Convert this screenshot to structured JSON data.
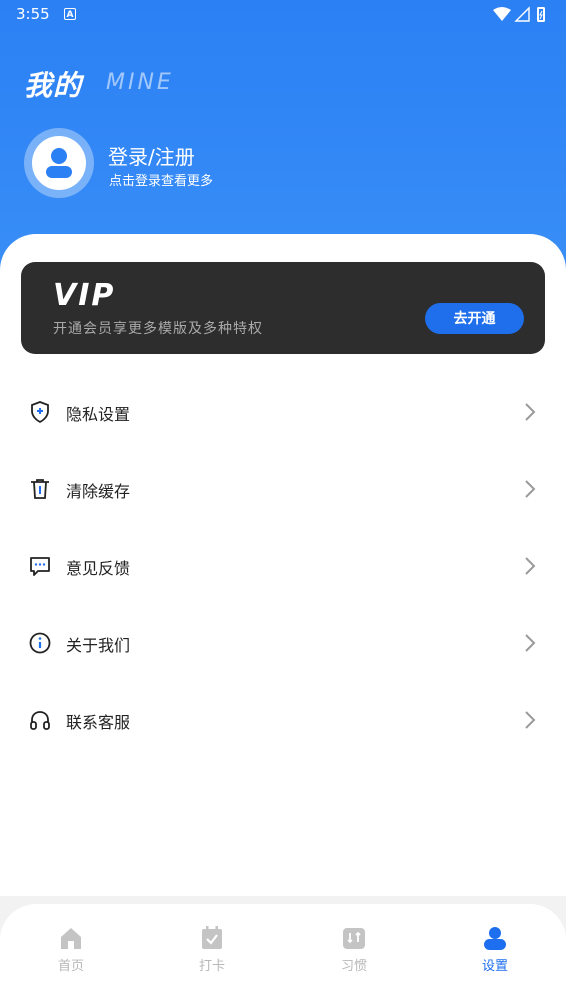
{
  "status_bar": {
    "time": "3:55",
    "notification_letter": "A"
  },
  "header": {
    "title": "我的",
    "subtitle": "MINE"
  },
  "user": {
    "login_label": "登录/注册",
    "login_hint": "点击登录查看更多"
  },
  "vip": {
    "logo_text": "VIP",
    "description": "开通会员享更多模版及多种特权",
    "button_label": "去开通"
  },
  "menu": [
    {
      "label": "隐私设置",
      "icon": "shield-icon"
    },
    {
      "label": "清除缓存",
      "icon": "trash-icon"
    },
    {
      "label": "意见反馈",
      "icon": "feedback-icon"
    },
    {
      "label": "关于我们",
      "icon": "info-icon"
    },
    {
      "label": "联系客服",
      "icon": "headset-icon"
    }
  ],
  "bottom_nav": [
    {
      "label": "首页",
      "icon": "home-icon",
      "active": false
    },
    {
      "label": "打卡",
      "icon": "checkin-icon",
      "active": false
    },
    {
      "label": "习惯",
      "icon": "habit-icon",
      "active": false
    },
    {
      "label": "设置",
      "icon": "settings-user-icon",
      "active": true
    }
  ],
  "colors": {
    "primary": "#2b80f4",
    "accent": "#1e6ff0",
    "vip_bg": "#2e2d2d",
    "inactive": "#b8b8b8"
  }
}
